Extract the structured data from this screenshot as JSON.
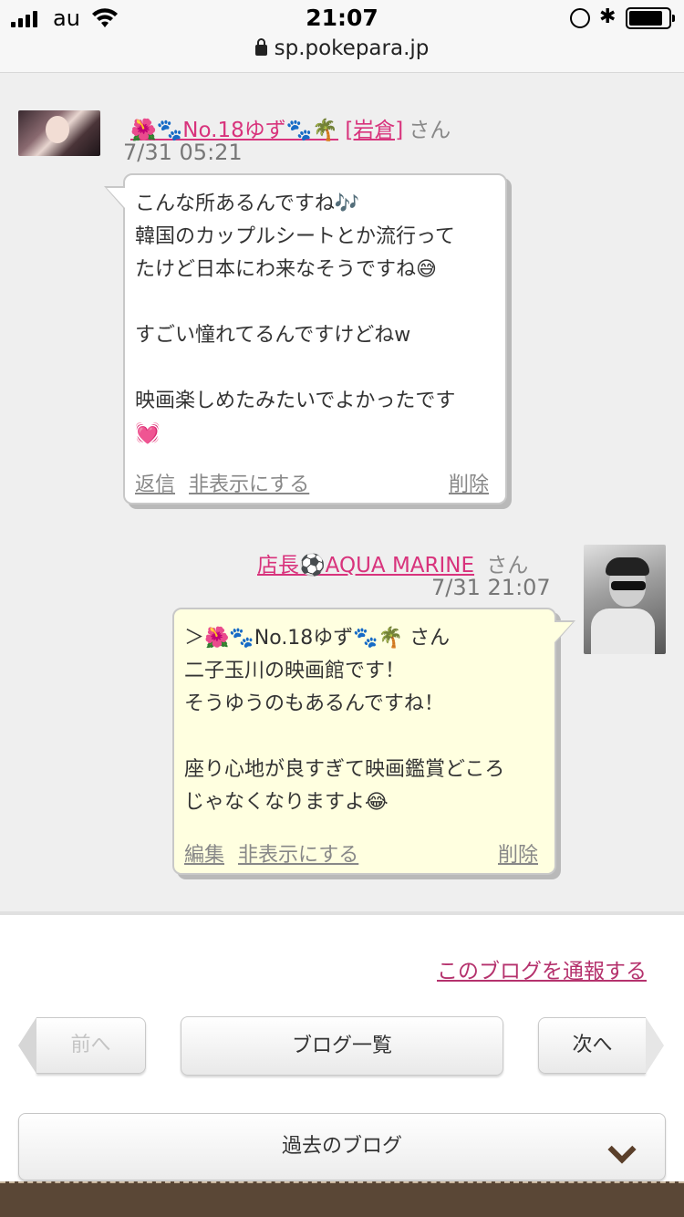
{
  "status_bar": {
    "carrier": "au",
    "time": "21:07",
    "url": "sp.pokepara.jp",
    "battery_level": 0.85
  },
  "comments": [
    {
      "author": "🌺🐾No.18ゆず🐾🌴",
      "author_tag": "[岩倉]",
      "suffix": "さん",
      "date": "7/31 05:21",
      "text": "こんな所あるんですね🎶\n韓国のカップルシートとか流行って\nたけど日本にわ来なそうですね😅\n\nすごい憧れてるんですけどねw\n\n映画楽しめたみたいでよかったです\n💓",
      "actions": {
        "reply": "返信",
        "hide": "非表示にする",
        "delete": "削除"
      }
    },
    {
      "author": "店長⚽AQUA MARINE",
      "suffix": "さん",
      "date": "7/31 21:07",
      "text": "＞🌺🐾No.18ゆず🐾🌴 さん\n二子玉川の映画館です！\nそうゆうのもあるんですね！\n\n座り心地が良すぎて映画鑑賞どころ\nじゃなくなりますよ😂",
      "actions": {
        "edit": "編集",
        "hide": "非表示にする",
        "delete": "削除"
      }
    }
  ],
  "footer": {
    "report_link": "このブログを通報する",
    "prev": "前へ",
    "list": "ブログ一覧",
    "next": "次へ",
    "past": "過去のブログ"
  }
}
